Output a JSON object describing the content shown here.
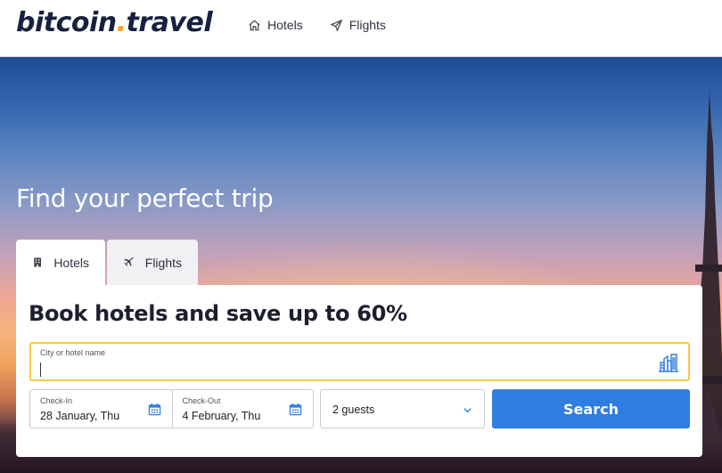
{
  "brand": {
    "name_part1": "bitcoin",
    "name_dot": ".",
    "name_part2": "travel"
  },
  "nav": {
    "hotels": "Hotels",
    "flights": "Flights"
  },
  "hero": {
    "title": "Find your perfect trip"
  },
  "tabs": {
    "hotels": "Hotels",
    "flights": "Flights",
    "active": "hotels"
  },
  "search": {
    "title": "Book hotels and save up to 60%",
    "city_label": "City or hotel name",
    "city_value": "",
    "checkin_label": "Check-In",
    "checkin_value": "28 January, Thu",
    "checkout_label": "Check-Out",
    "checkout_value": "4 February, Thu",
    "guests_value": "2 guests",
    "button_label": "Search"
  },
  "icons": {
    "nav_hotels": "home-icon",
    "nav_flights": "plane-icon",
    "tab_hotels": "building-icon",
    "tab_flights": "plane-icon",
    "city": "city-skyline-icon",
    "calendar": "calendar-icon",
    "dropdown": "chevron-down-icon"
  },
  "colors": {
    "accent": "#2f7de1",
    "logo_dot": "#f7a21b",
    "field_focus": "#f6c945",
    "text_dark": "#16213f"
  }
}
